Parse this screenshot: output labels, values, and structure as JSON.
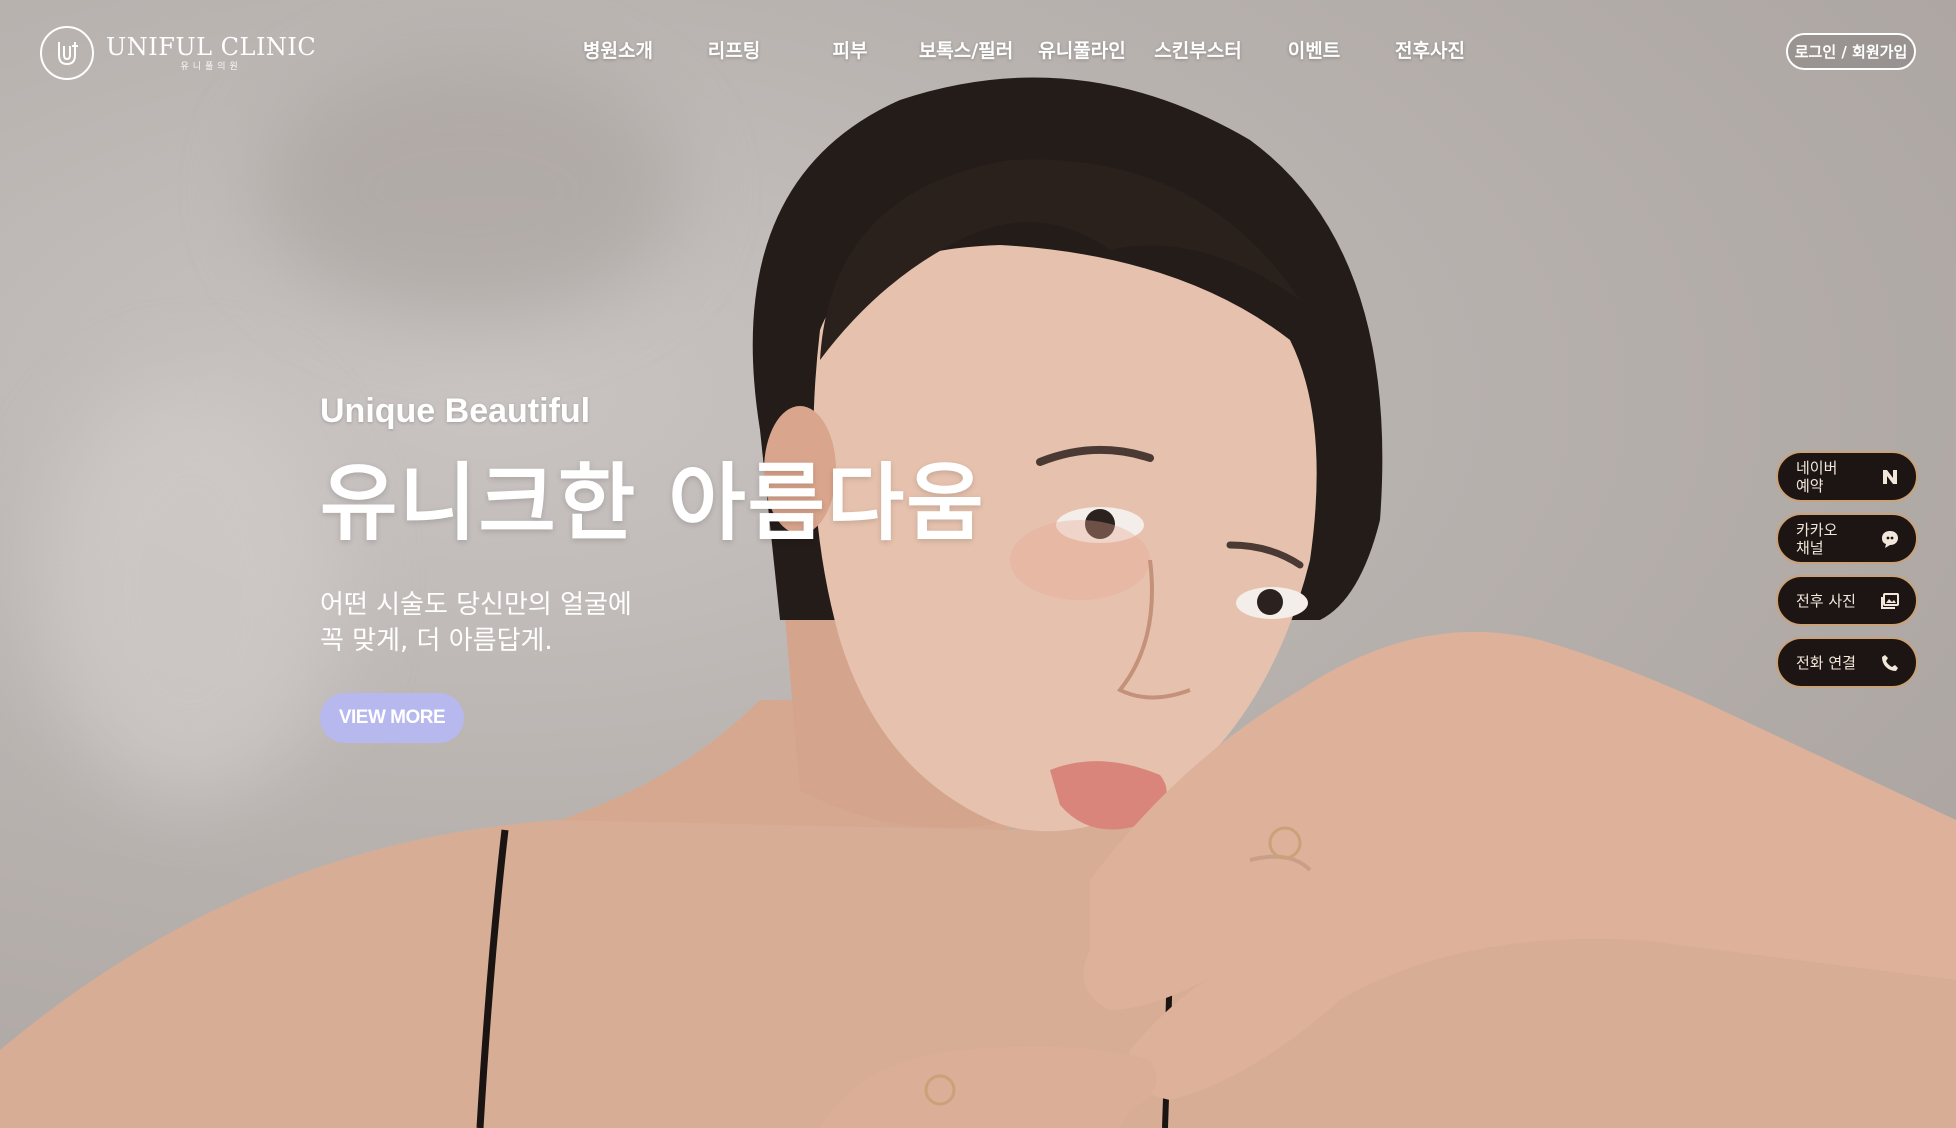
{
  "header": {
    "logo": {
      "title": "UNIFUL CLINIC",
      "subtitle": "유니풀의원"
    },
    "nav": [
      {
        "label": "병원소개"
      },
      {
        "label": "리프팅"
      },
      {
        "label": "피부"
      },
      {
        "label": "보톡스/필러"
      },
      {
        "label": "유니풀라인"
      },
      {
        "label": "스킨부스터"
      },
      {
        "label": "이벤트"
      },
      {
        "label": "전후사진"
      }
    ],
    "login_label": "로그인 / 회원가입"
  },
  "hero": {
    "eyebrow": "Unique Beautiful",
    "title": "유니크한 아름다움",
    "desc_line1": "어떤 시술도 당신만의 얼굴에",
    "desc_line2": "꼭 맞게, 더 아름답게.",
    "button_label": "VIEW MORE"
  },
  "quick_menu": [
    {
      "label": "네이버\n예약",
      "icon": "naver-icon"
    },
    {
      "label": "카카오\n채널",
      "icon": "kakao-channel-icon"
    },
    {
      "label": "전후 사진",
      "icon": "photo-icon"
    },
    {
      "label": "전화 연결",
      "icon": "phone-icon"
    }
  ],
  "colors": {
    "accent_button": "#b6b8ee",
    "quick_menu_bg": "#1c1513",
    "quick_menu_border": "#c9a27a"
  }
}
